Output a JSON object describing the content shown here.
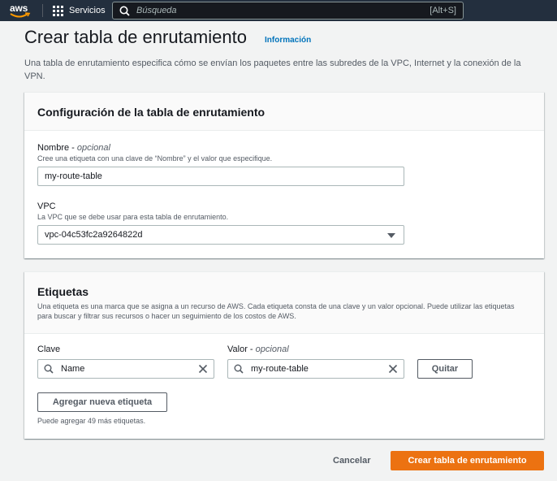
{
  "nav": {
    "logo_text": "aws",
    "services_label": "Servicios",
    "search_placeholder": "Búsqueda",
    "search_shortcut": "[Alt+S]"
  },
  "page": {
    "title": "Crear tabla de enrutamiento",
    "info_link": "Información",
    "description": "Una tabla de enrutamiento especifica cómo se envían los paquetes entre las subredes de la VPC, Internet y la conexión de la VPN."
  },
  "config_section": {
    "title": "Configuración de la tabla de enrutamiento",
    "name_label": "Nombre",
    "name_optional": "opcional",
    "name_hint": "Cree una etiqueta con una clave de “Nombre” y el valor que especifique.",
    "name_value": "my-route-table",
    "vpc_label": "VPC",
    "vpc_hint": "La VPC que se debe usar para esta tabla de enrutamiento.",
    "vpc_value": "vpc-04c53fc2a9264822d"
  },
  "tags_section": {
    "title": "Etiquetas",
    "description": "Una etiqueta es una marca que se asigna a un recurso de AWS. Cada etiqueta consta de una clave y un valor opcional. Puede utilizar las etiquetas para buscar y filtrar sus recursos o hacer un seguimiento de los costos de AWS.",
    "key_label": "Clave",
    "value_label": "Valor",
    "value_optional": "opcional",
    "tags": [
      {
        "key": "Name",
        "value": "my-route-table"
      }
    ],
    "remove_label": "Quitar",
    "add_label": "Agregar nueva etiqueta",
    "remaining_hint": "Puede agregar 49 más etiquetas."
  },
  "footer": {
    "cancel_label": "Cancelar",
    "create_label": "Crear tabla de enrutamiento"
  },
  "colors": {
    "nav_bg": "#232f3e",
    "primary": "#ec7211",
    "link": "#0073bb",
    "logo_smile": "#ff9900"
  }
}
